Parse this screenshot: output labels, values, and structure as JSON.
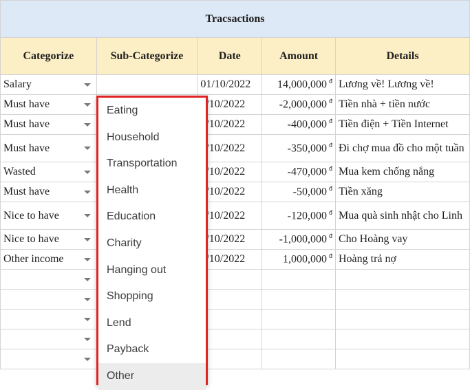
{
  "title": "Tracsactions",
  "headers": [
    "Categorize",
    "Sub-Categorize",
    "Date",
    "Amount",
    "Details"
  ],
  "currency_symbol": "đ",
  "rows": [
    {
      "category": "Salary",
      "date": "01/10/2022",
      "amount": "14,000,000",
      "details": "Lương về! Lương về!"
    },
    {
      "category": "Must have",
      "date": "1/10/2022",
      "amount": "-2,000,000",
      "details": "Tiền nhà + tiền nước"
    },
    {
      "category": "Must have",
      "date": "2/10/2022",
      "amount": "-400,000",
      "details": "Tiền điện + Tiền Internet"
    },
    {
      "category": "Must have",
      "date": "2/10/2022",
      "amount": "-350,000",
      "details": "Đi chợ mua đồ cho một tuần"
    },
    {
      "category": "Wasted",
      "date": "4/10/2022",
      "amount": "-470,000",
      "details": "Mua kem chống nắng"
    },
    {
      "category": "Must have",
      "date": "5/10/2022",
      "amount": "-50,000",
      "details": "Tiền xăng"
    },
    {
      "category": "Nice to have",
      "date": "6/10/2022",
      "amount": "-120,000",
      "details": "Mua quà sinh nhật cho Linh"
    },
    {
      "category": "Nice to have",
      "date": "7/10/2022",
      "amount": "-1,000,000",
      "details": "Cho Hoàng vay"
    },
    {
      "category": "Other income",
      "date": "8/10/2022",
      "amount": "1,000,000",
      "details": "Hoàng trả nợ"
    }
  ],
  "dropdown": {
    "options": [
      "Eating",
      "Household",
      "Transportation",
      "Health",
      "Education",
      "Charity",
      "Hanging out",
      "Shopping",
      "Lend",
      "Payback",
      "Other"
    ],
    "highlighted": "Other",
    "outline_color": "#e02424"
  },
  "colors": {
    "title_bg": "#dde9f6",
    "header_bg": "#fdefc5",
    "selection": "#1a73e8"
  }
}
